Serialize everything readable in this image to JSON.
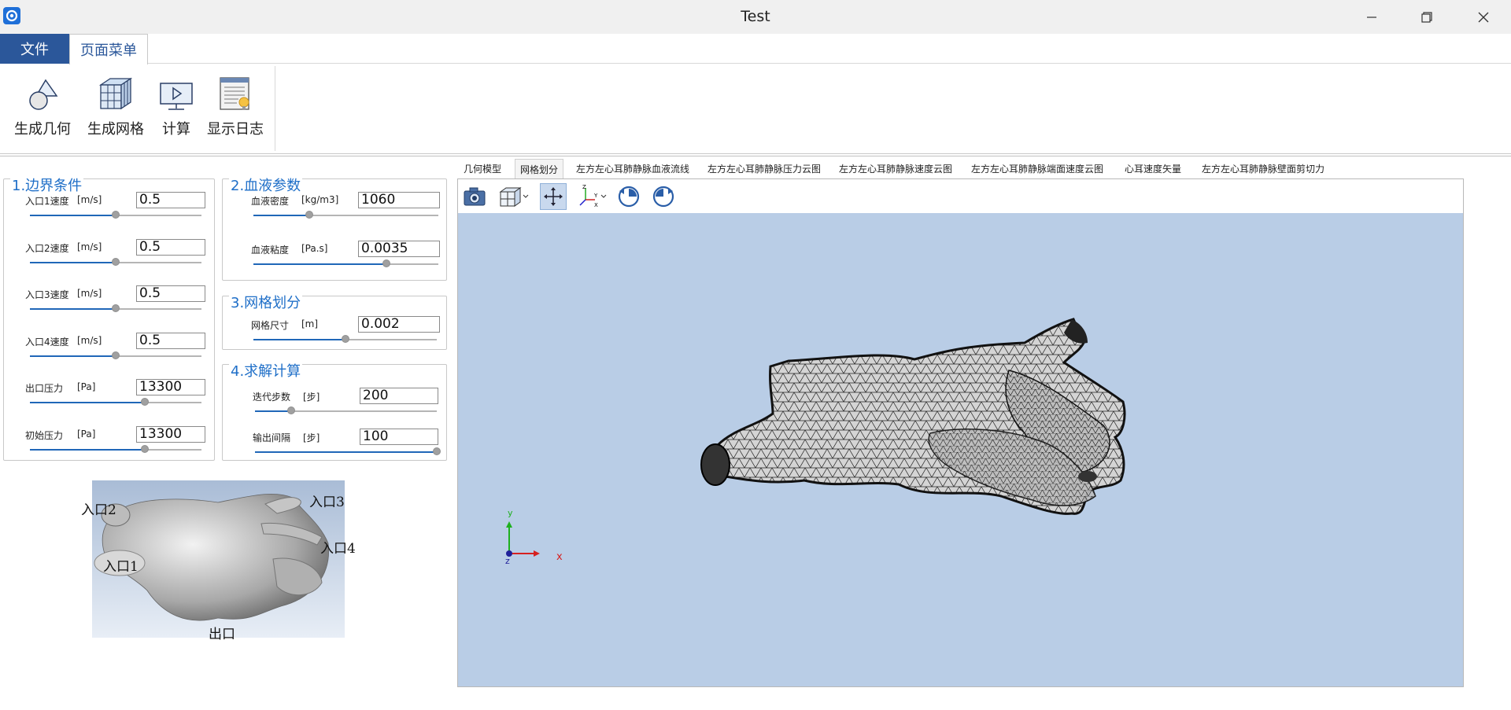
{
  "window": {
    "title": "Test"
  },
  "menubar": {
    "file": "文件",
    "page_menu": "页面菜单"
  },
  "ribbon": {
    "buttons": [
      {
        "label": "生成几何",
        "icon": "geometry-icon"
      },
      {
        "label": "生成网格",
        "icon": "mesh-cube-icon"
      },
      {
        "label": "计算",
        "icon": "compute-monitor-icon"
      },
      {
        "label": "显示日志",
        "icon": "log-icon"
      }
    ]
  },
  "panels": {
    "boundary": {
      "title": "1.边界条件",
      "params": [
        {
          "label": "入口1速度",
          "unit": "[m/s]",
          "value": "0.5",
          "level": 0.5
        },
        {
          "label": "入口2速度",
          "unit": "[m/s]",
          "value": "0.5",
          "level": 0.5
        },
        {
          "label": "入口3速度",
          "unit": "[m/s]",
          "value": "0.5",
          "level": 0.5
        },
        {
          "label": "入口4速度",
          "unit": "[m/s]",
          "value": "0.5",
          "level": 0.5
        },
        {
          "label": "出口压力",
          "unit": "[Pa]",
          "value": "13300",
          "level": 0.67
        },
        {
          "label": "初始压力",
          "unit": "[Pa]",
          "value": "13300",
          "level": 0.67
        }
      ]
    },
    "blood": {
      "title": "2.血液参数",
      "params": [
        {
          "label": "血液密度",
          "unit": "[kg/m3]",
          "value": "1060",
          "level": 0.3
        },
        {
          "label": "血液粘度",
          "unit": "[Pa.s]",
          "value": "0.0035",
          "level": 0.72
        }
      ]
    },
    "mesh": {
      "title": "3.网格划分",
      "params": [
        {
          "label": "网格尺寸",
          "unit": "[m]",
          "value": "0.002",
          "level": 0.5
        }
      ]
    },
    "solve": {
      "title": "4.求解计算",
      "params": [
        {
          "label": "迭代步数",
          "unit": "[步]",
          "value": "200",
          "level": 0.2
        },
        {
          "label": "输出间隔",
          "unit": "[步]",
          "value": "100",
          "level": 1.0
        }
      ]
    }
  },
  "preview": {
    "labels": {
      "inlet1": "入口1",
      "inlet2": "入口2",
      "inlet3": "入口3",
      "inlet4": "入口4",
      "outlet": "出口"
    }
  },
  "tabs": [
    {
      "label": "几何模型"
    },
    {
      "label": "网格划分",
      "active": true
    },
    {
      "label": "左方左心耳肺静脉血液流线"
    },
    {
      "label": "左方左心耳肺静脉压力云图"
    },
    {
      "label": "左方左心耳肺静脉速度云图"
    },
    {
      "label": "左方左心耳肺静脉端面速度云图"
    },
    {
      "label": "心耳速度矢量"
    },
    {
      "label": "左方左心耳肺静脉壁面剪切力"
    }
  ],
  "axes": {
    "x": "x",
    "y": "y",
    "z": "z"
  },
  "colors": {
    "accent": "#2b579a",
    "title_blue": "#1f6fc8",
    "viewport_bg": "#b9cde6"
  }
}
